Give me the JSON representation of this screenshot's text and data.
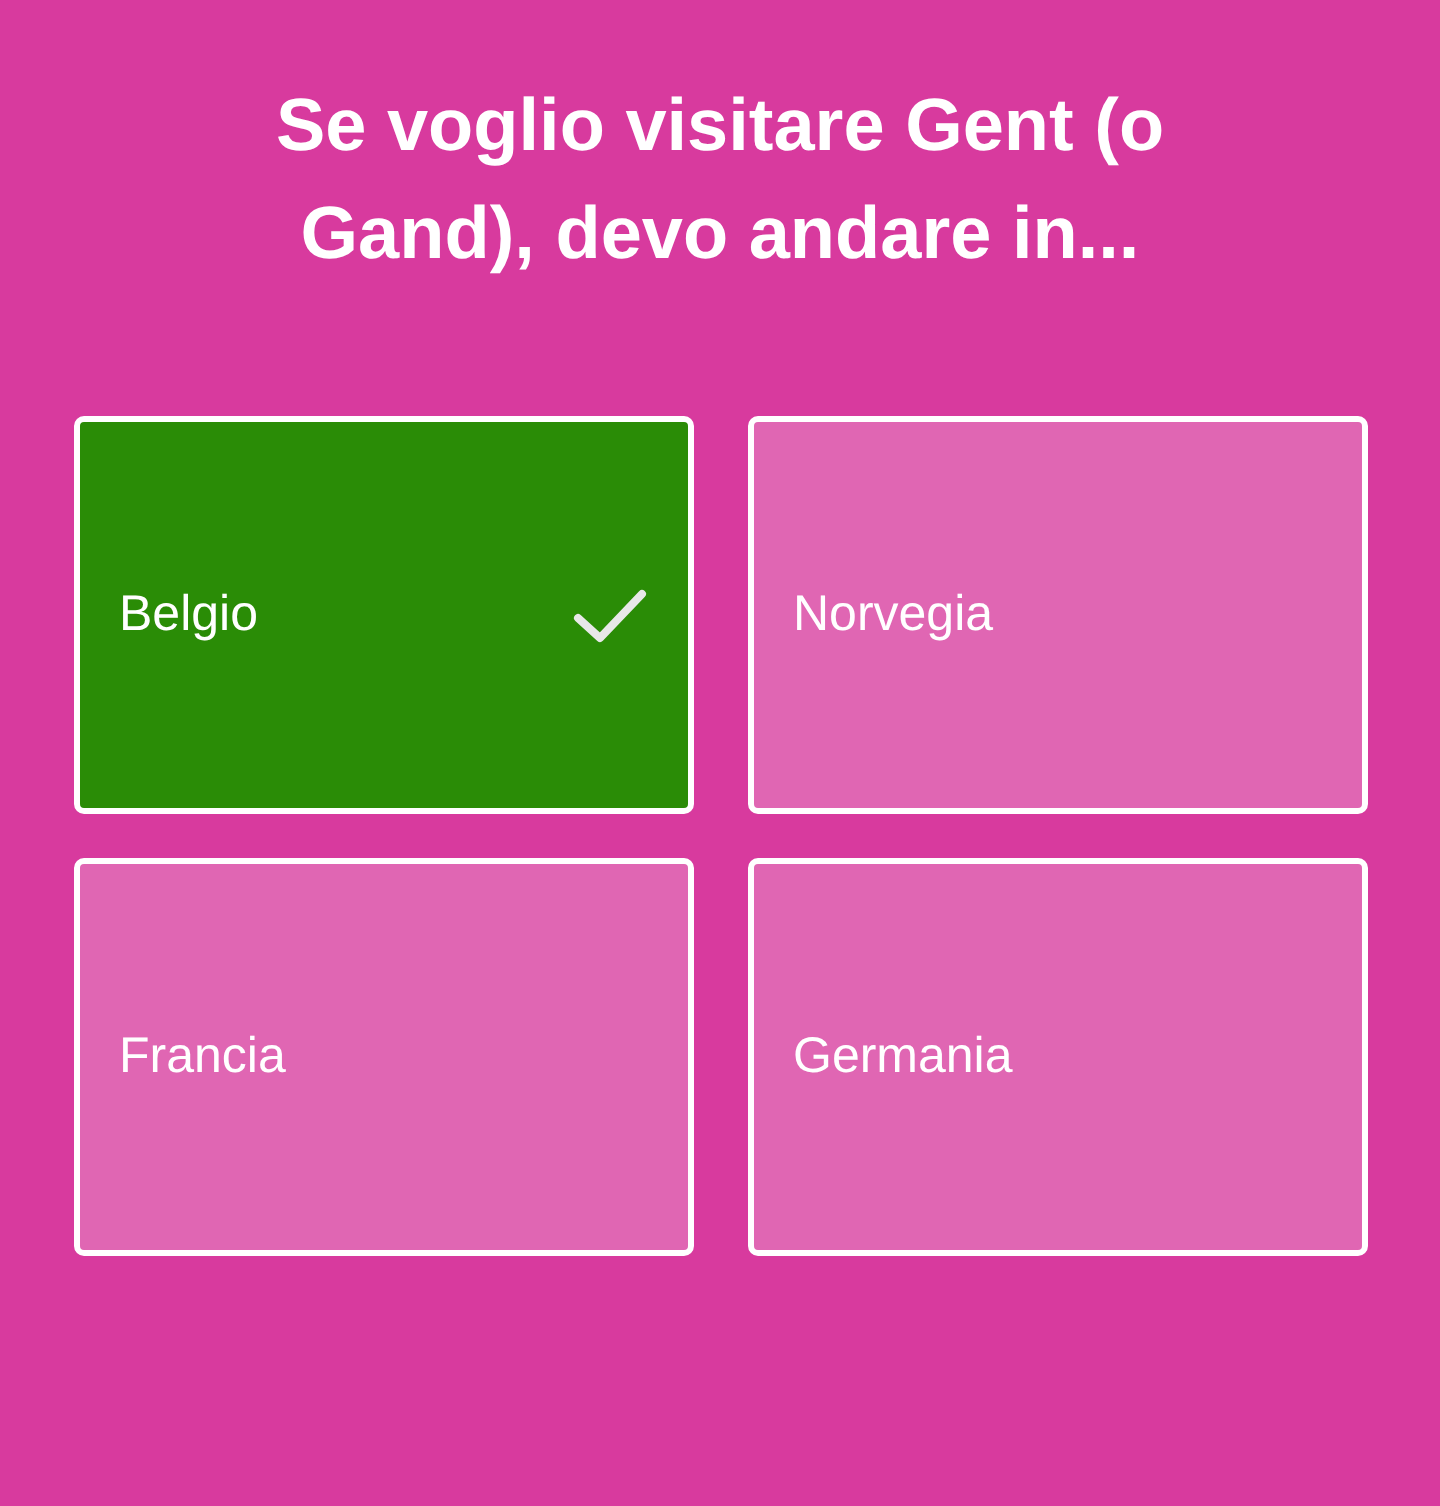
{
  "question": "Se voglio visitare Gent (o Gand), devo andare in...",
  "answers": [
    {
      "label": "Belgio",
      "selected": true
    },
    {
      "label": "Norvegia",
      "selected": false
    },
    {
      "label": "Francia",
      "selected": false
    },
    {
      "label": "Germania",
      "selected": false
    }
  ]
}
